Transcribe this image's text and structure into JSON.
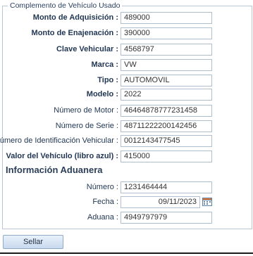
{
  "legend": "Complemento de Vehículo Usado",
  "fields": [
    {
      "label": "Monto de Adquisición :",
      "value": "489000"
    },
    {
      "label": "Monto de Enajenación :",
      "value": "390000"
    },
    {
      "label": "Clave Vehicular :",
      "value": "4568797"
    },
    {
      "label": "Marca :",
      "value": "VW"
    },
    {
      "label": "Tipo :",
      "value": "AUTOMOVIL"
    },
    {
      "label": "Modelo :",
      "value": "2022"
    },
    {
      "label": "Número de Motor :",
      "value": "46464878777231458"
    },
    {
      "label": "Número de Serie :",
      "value": "48711222200142456"
    },
    {
      "label": "Número de Identificación Vehicular :",
      "value": "0012143477545"
    },
    {
      "label": "Valor del Vehículo (libro azul) :",
      "value": "415000"
    }
  ],
  "customs": {
    "title": "Información Aduanera",
    "fields": [
      {
        "label": "Número :",
        "value": "1231464444"
      },
      {
        "label": "Fecha :",
        "value": "09/11/2023"
      },
      {
        "label": "Aduana :",
        "value": "4949797979"
      }
    ]
  },
  "button": {
    "label": "Sellar"
  },
  "icons": {
    "calendar": "calendar-icon"
  }
}
